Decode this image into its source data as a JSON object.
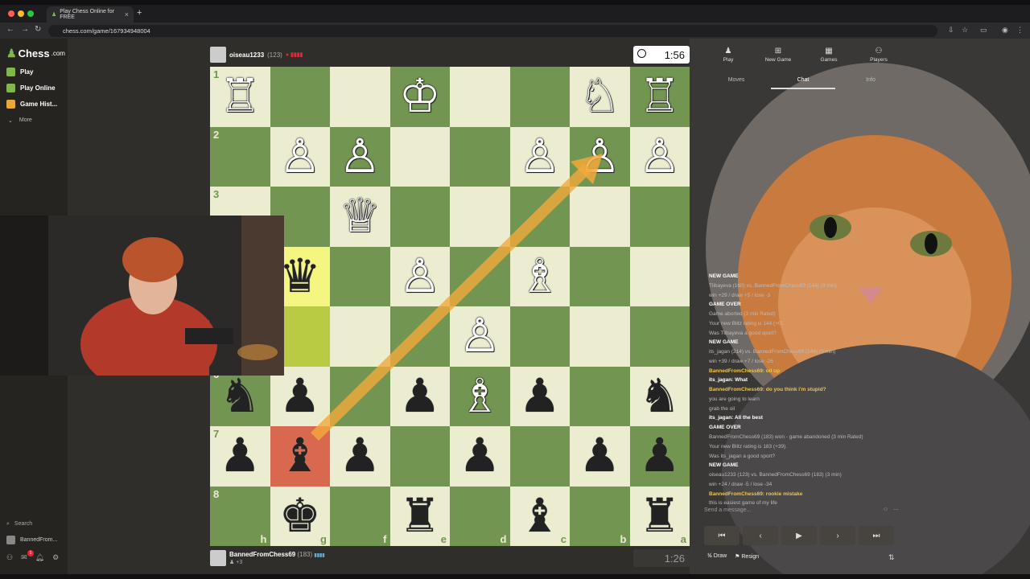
{
  "browser": {
    "tab_title": "Play Chess Online for FREE",
    "url": "chess.com/game/167934948004"
  },
  "sidebar": {
    "logo": "Chess",
    "logo_suffix": ".com",
    "items": [
      {
        "label": "Play"
      },
      {
        "label": "Play Online"
      },
      {
        "label": "Game Hist..."
      }
    ],
    "more": "More",
    "search": "Search",
    "user": "BannedFrom...",
    "notif_count": "1"
  },
  "players": {
    "top": {
      "name": "oiseau1233",
      "rating": "(123)",
      "clock": "1:56"
    },
    "bottom": {
      "name": "BannedFromChess69",
      "rating": "(183)",
      "material": "+3",
      "clock": "1:26"
    }
  },
  "board": {
    "ranks": [
      "1",
      "2",
      "3",
      "4",
      "5",
      "6",
      "7",
      "8"
    ],
    "files": [
      "h",
      "g",
      "f",
      "e",
      "d",
      "c",
      "b",
      "a"
    ],
    "rows": [
      [
        "wR",
        "",
        "",
        "wK",
        "",
        "",
        "wN",
        "wR"
      ],
      [
        "",
        "wP",
        "wP",
        "",
        "",
        "wP",
        "wP",
        "wP"
      ],
      [
        "",
        "",
        "wQ",
        "",
        "",
        "",
        "",
        ""
      ],
      [
        "",
        "bQ",
        "",
        "wP",
        "",
        "wB",
        "",
        ""
      ],
      [
        "",
        "",
        "",
        "",
        "wP",
        "",
        "",
        ""
      ],
      [
        "bN",
        "bP",
        "",
        "bP",
        "wB",
        "bP",
        "",
        "bN"
      ],
      [
        "bP",
        "bB",
        "bP",
        "",
        "bP",
        "",
        "bP",
        "bP"
      ],
      [
        "",
        "bK",
        "",
        "bR",
        "",
        "bB",
        "",
        "bR"
      ]
    ],
    "highlights": {
      "yellow": [
        3,
        1
      ],
      "green": [
        4,
        1
      ],
      "red": [
        6,
        1
      ]
    }
  },
  "right": {
    "nav": [
      "Play",
      "New Game",
      "Games",
      "Players"
    ],
    "subtabs": [
      "Moves",
      "Chat",
      "Info"
    ],
    "chat": [
      {
        "type": "h",
        "text": "NEW GAME"
      },
      {
        "type": "s",
        "text": "Tlibayeva (160) vs. BannedFromChess69 (144) (3 min)"
      },
      {
        "type": "s",
        "text": "win +29 / draw +5 / lose -3"
      },
      {
        "type": "h",
        "text": "GAME OVER"
      },
      {
        "type": "s",
        "text": "Game aborted (3 min Rated)"
      },
      {
        "type": "s",
        "text": "Your new Blitz rating is 144 (+0)."
      },
      {
        "type": "s",
        "text": "Was Tlibayeva a good sport?"
      },
      {
        "type": "h",
        "text": "NEW GAME"
      },
      {
        "type": "s",
        "text": "its_jagan (214) vs. BannedFromChess69 (144) (3 min)"
      },
      {
        "type": "s",
        "text": "win +39 / draw +7 / lose -26"
      },
      {
        "type": "y",
        "text": "BannedFromChess69: oil up"
      },
      {
        "type": "w",
        "text": "its_jagan: What"
      },
      {
        "type": "y",
        "text": "BannedFromChess69: do you think i'm stupid?"
      },
      {
        "type": "s",
        "text": "you are going to learn"
      },
      {
        "type": "s",
        "text": "grab the oil"
      },
      {
        "type": "w",
        "text": "its_jagan: All the best"
      },
      {
        "type": "h",
        "text": "GAME OVER"
      },
      {
        "type": "s",
        "text": "BannedFromChess69 (183) won - game abandoned (3 min Rated)"
      },
      {
        "type": "s",
        "text": "Your new Blitz rating is 183 (+39)."
      },
      {
        "type": "s",
        "text": "Was its_jagan a good sport?"
      },
      {
        "type": "h",
        "text": "NEW GAME"
      },
      {
        "type": "s",
        "text": "oiseau1233 (123) vs. BannedFromChess69 (183) (3 min)"
      },
      {
        "type": "s",
        "text": "win +24 / draw -5 / lose -34"
      },
      {
        "type": "y",
        "text": "BannedFromChess69: rookie mistake"
      },
      {
        "type": "s",
        "text": "this is easiest game of my life"
      }
    ],
    "message_placeholder": "Send a message...",
    "draw": "Draw",
    "resign": "Resign"
  }
}
